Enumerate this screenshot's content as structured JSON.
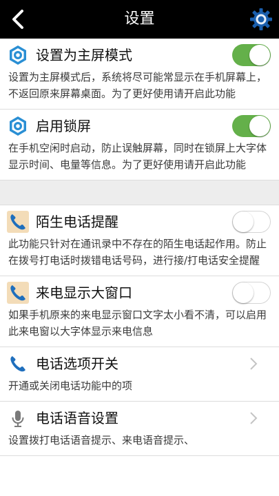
{
  "header": {
    "title": "设置"
  },
  "items": [
    {
      "title": "设置为主屏模式",
      "desc": "设置为主屏模式后，系统将尽可能常显示在手机屏幕上，不返回原来屏幕桌面。为了更好使用请开启此功能",
      "icon": "hexagon-gear-icon",
      "toggle": "on"
    },
    {
      "title": "启用锁屏",
      "desc": "在手机空闲时启动，防止误触屏幕，同时在锁屏上大字体显示时间、电量等信息。为了更好使用请开启此功能",
      "icon": "hexagon-gear-icon",
      "toggle": "on"
    },
    {
      "title": "陌生电话提醒",
      "desc": "此功能只针对在通讯录中不存在的陌生电话起作用。防止在拨号打电话时拨错电话号码，进行接/打电话安全提醒",
      "icon": "phone-icon",
      "toggle": "off"
    },
    {
      "title": "来电显示大窗口",
      "desc": "如果手机原来的来电显示窗口文字太小看不清，可以启用此来电窗以大字体显示来电信息",
      "icon": "phone-icon",
      "toggle": "off"
    },
    {
      "title": "电话选项开关",
      "desc": "开通或关闭电话功能中的项",
      "icon": "phone-icon"
    },
    {
      "title": "电话语音设置",
      "desc": "设置拨打电话语音提示、来电语音提示、",
      "icon": "microphone-icon"
    }
  ],
  "colors": {
    "header_bg": "#000000",
    "toggle_on": "#64b04a",
    "accent_blue": "#2a6fb8",
    "section_gap": "#ededed"
  }
}
